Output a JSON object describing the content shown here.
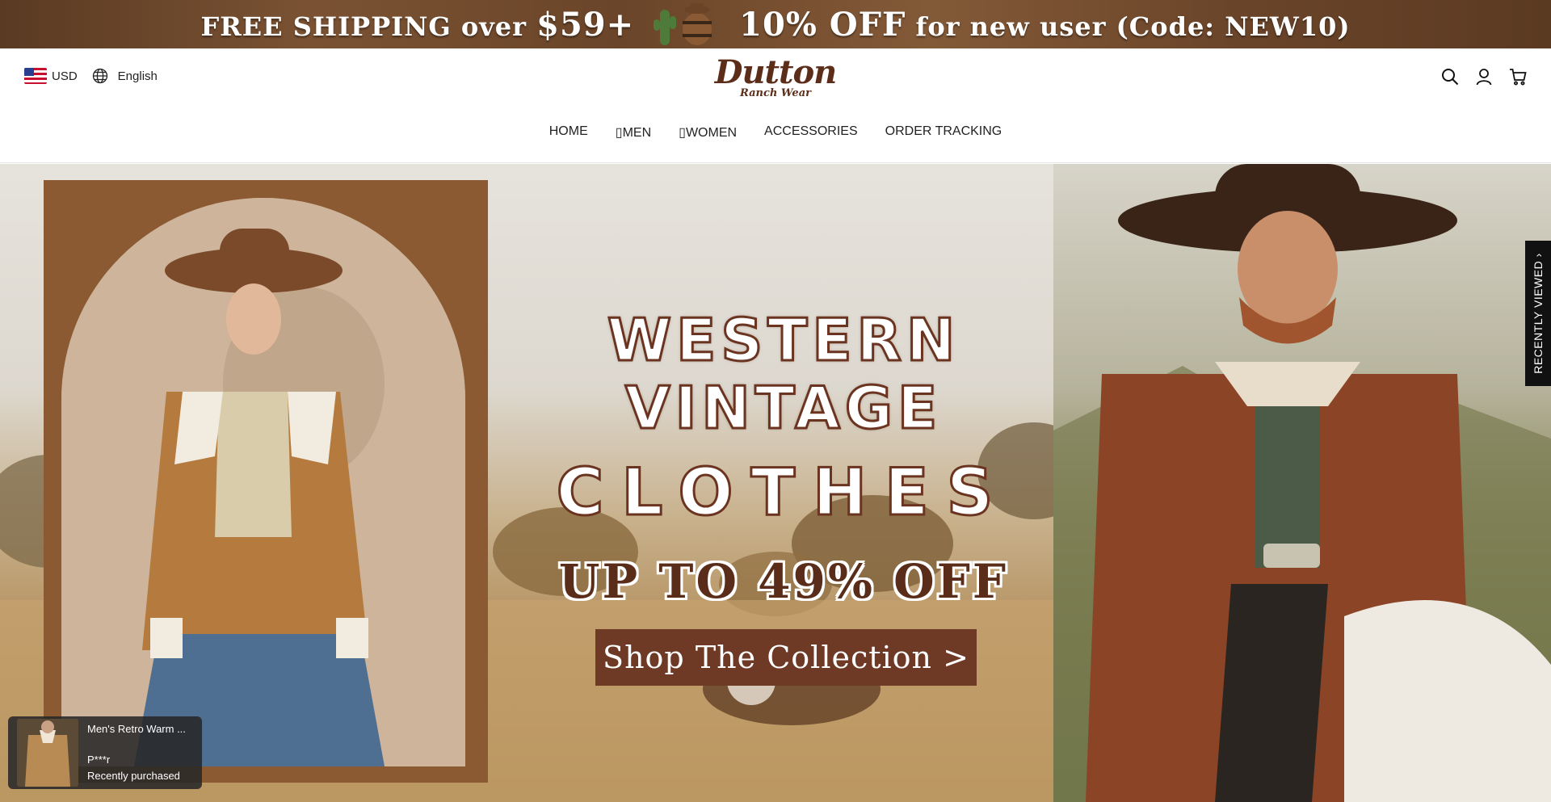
{
  "announcement": {
    "part1_prefix": "FREE SHIPPING over ",
    "part1_amount": "$59+",
    "part2_percent": "10% OFF",
    "part2_suffix": " for new user (Code: NEW10)"
  },
  "header": {
    "currency": "USD",
    "language": "English",
    "logo_line1": "Dutton",
    "logo_line2": "Ranch Wear",
    "icons": [
      "search-icon",
      "account-icon",
      "cart-icon"
    ]
  },
  "nav": {
    "items": [
      {
        "label": "HOME"
      },
      {
        "label": "MEN"
      },
      {
        "label": "WOMEN"
      },
      {
        "label": "ACCESSORIES"
      },
      {
        "label": "ORDER TRACKING"
      }
    ]
  },
  "hero": {
    "headline_line1": "WESTERN VINTAGE",
    "headline_line2": "CLOTHES",
    "headline_line3": "UP TO 49% OFF",
    "cta_label": "Shop The Collection >"
  },
  "recently_viewed": {
    "label": "RECENTLY VIEWED"
  },
  "purchase_popup": {
    "product": "Men's Retro Warm ...",
    "user": "P***r",
    "status": "Recently purchased"
  },
  "colors": {
    "brand_brown": "#6e3a26",
    "logo_brown": "#5c2e1a"
  }
}
